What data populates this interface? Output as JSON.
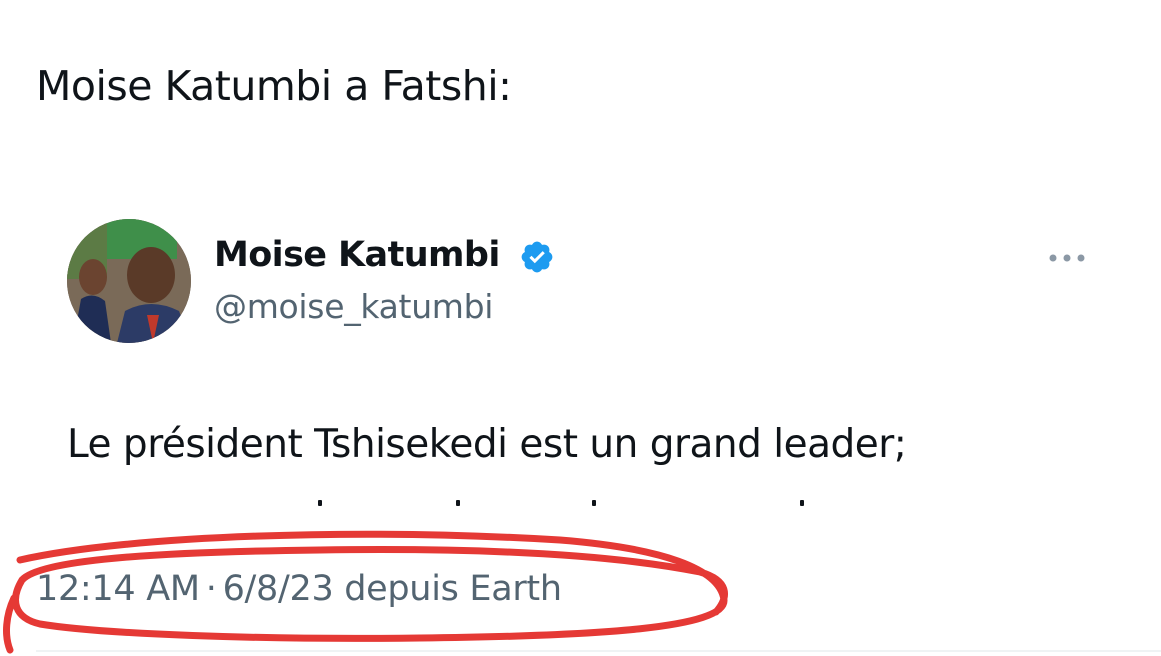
{
  "heading": "Moise Katumbi a Fatshi:",
  "tweet": {
    "author_name": "Moise Katumbi",
    "author_handle": "@moise_katumbi",
    "verified_badge": "verified-check-icon",
    "more_menu": "more-options-icon",
    "text": "Le président Tshisekedi est un grand leader;",
    "time": "12:14 AM",
    "separator": "·",
    "date_source": "6/8/23 depuis Earth"
  },
  "colors": {
    "text": "#0f1419",
    "secondary": "#536471",
    "verified": "#1d9bf0",
    "annotation": "#e53935"
  }
}
